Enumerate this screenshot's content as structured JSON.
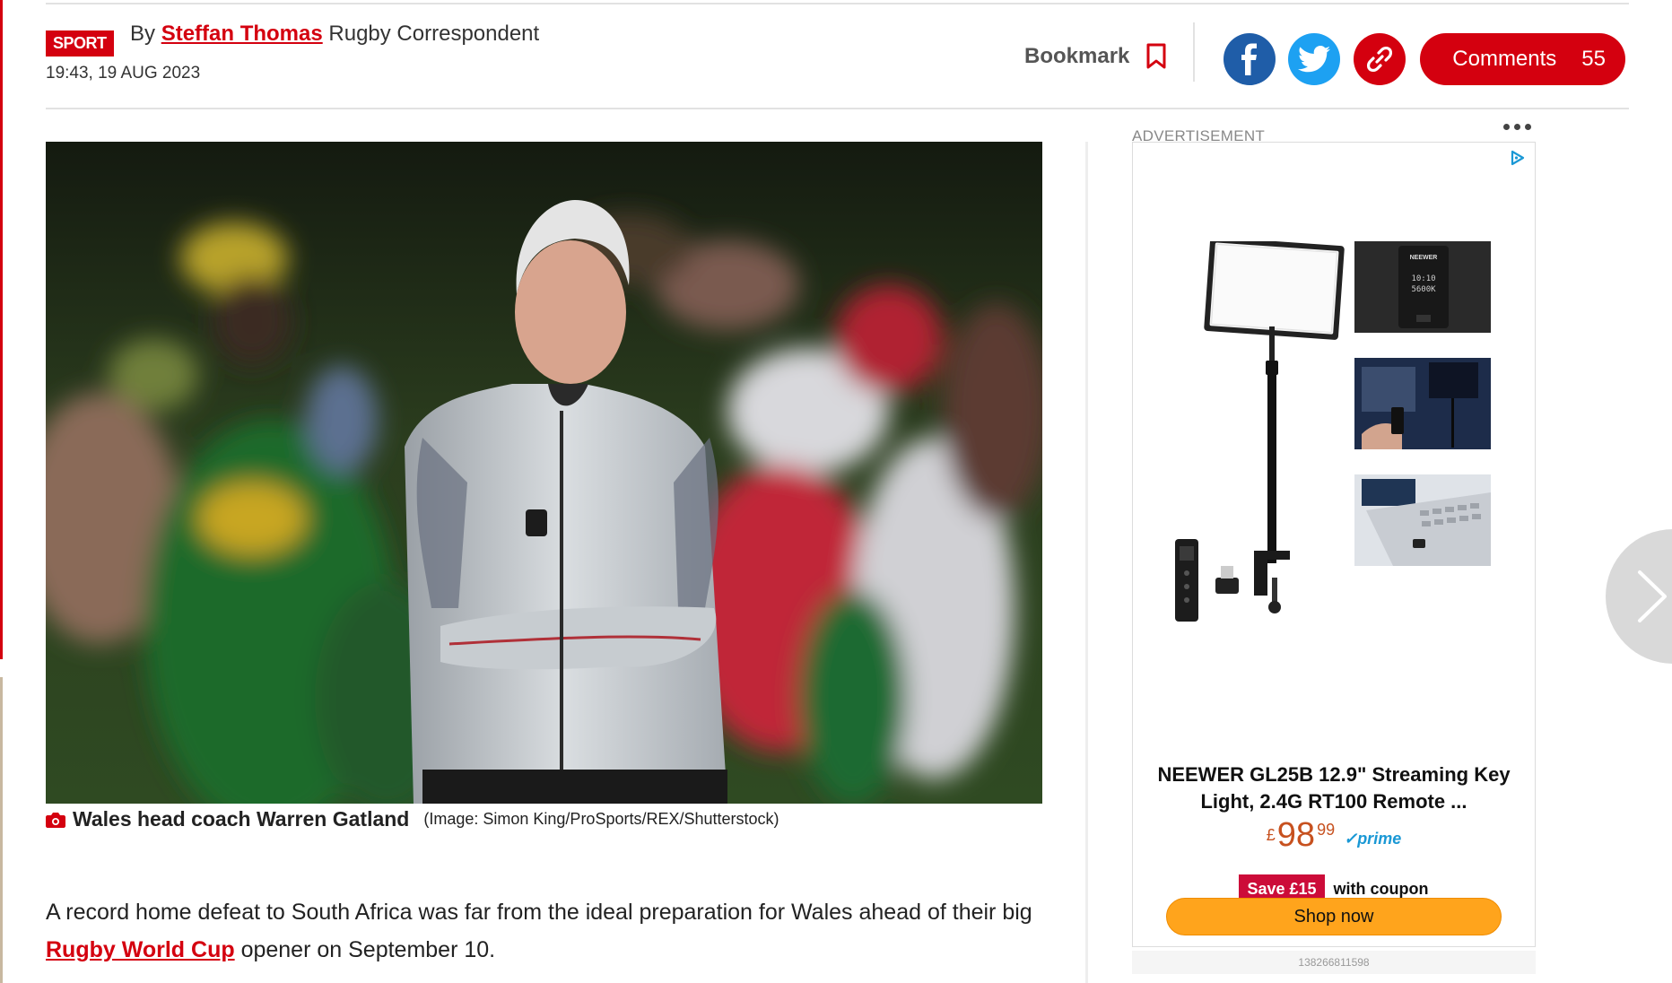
{
  "article": {
    "section_badge": "SPORT",
    "byline_prefix": "By",
    "author": "Steffan Thomas",
    "author_role": "Rugby Correspondent",
    "timestamp": "19:43, 19 AUG 2023"
  },
  "toolbar": {
    "bookmark_label": "Bookmark",
    "comments_label": "Comments",
    "comments_count": "55"
  },
  "hero_image": {
    "caption_title": "Wales head coach Warren Gatland",
    "caption_credit": "(Image: Simon King/ProSports/REX/Shutterstock)"
  },
  "body": {
    "p1_before": "A record home defeat to South Africa was far from the ideal preparation for Wales ahead of their big ",
    "p1_link": "Rugby World Cup",
    "p1_after": " opener on September 10."
  },
  "advertisement": {
    "label": "ADVERTISEMENT",
    "product_title": "NEEWER GL25B 12.9\" Streaming Key Light, 2.4G RT100 Remote ...",
    "price_currency": "£",
    "price_main": "98",
    "price_cents": "99",
    "prime_label": "prime",
    "save_badge": "Save £15",
    "coupon_text": "with coupon",
    "shop_button": "Shop now",
    "ad_id": "138266811598",
    "brand_on_device": "NEEWER",
    "device_readout_1": "10:10",
    "device_readout_2": "5600K"
  },
  "colors": {
    "brand_red": "#d4000f",
    "facebook": "#1f5da8",
    "twitter": "#1da1f2",
    "amazon_orange": "#ffa41c",
    "price": "#c7511f"
  }
}
